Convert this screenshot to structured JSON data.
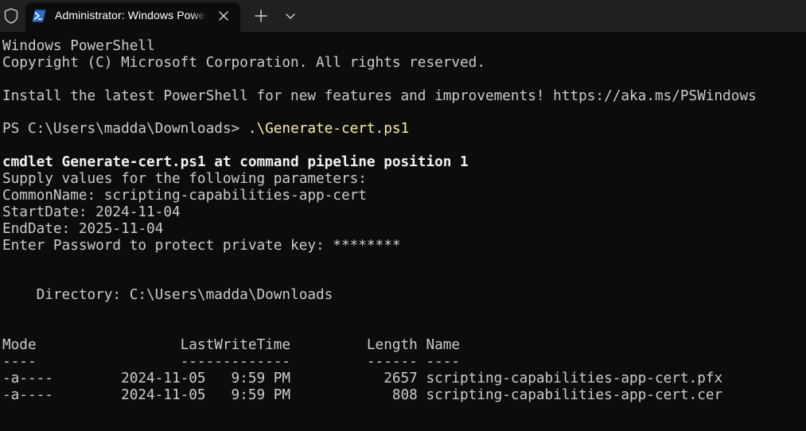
{
  "window": {
    "tab_title": "Administrator: Windows PowerShell",
    "icons": {
      "admin": "shield-icon",
      "tab": "powershell-icon",
      "close": "close-icon",
      "new_tab": "plus-icon",
      "dropdown": "chevron-down-icon"
    }
  },
  "colors": {
    "background": "#0c0c0c",
    "titlebar": "#202020",
    "text": "#cccccc",
    "command": "#f9f1a5",
    "accent": "#0f6cbd"
  },
  "terminal": {
    "banner_title": "Windows PowerShell",
    "copyright": "Copyright (C) Microsoft Corporation. All rights reserved.",
    "install_notice": "Install the latest PowerShell for new features and improvements! https://aka.ms/PSWindows",
    "prompt": "PS C:\\Users\\madda\\Downloads> ",
    "command": ".\\Generate-cert.ps1",
    "cmdlet_line": "cmdlet Generate-cert.ps1 at command pipeline position 1",
    "supply_line": "Supply values for the following parameters:",
    "common_name_line": "CommonName: scripting-capabilities-app-cert",
    "start_date_line": "StartDate: 2024-11-04",
    "end_date_line": "EndDate: 2025-11-04",
    "password_line": "Enter Password to protect private key: ********",
    "directory_line": "    Directory: C:\\Users\\madda\\Downloads",
    "table_header": "Mode                 LastWriteTime         Length Name",
    "table_underline": "----                 -------------         ------ ----",
    "rows": [
      {
        "text": "-a----        2024-11-05   9:59 PM           2657 scripting-capabilities-app-cert.pfx"
      },
      {
        "text": "-a----        2024-11-05   9:59 PM            808 scripting-capabilities-app-cert.cer"
      }
    ]
  }
}
